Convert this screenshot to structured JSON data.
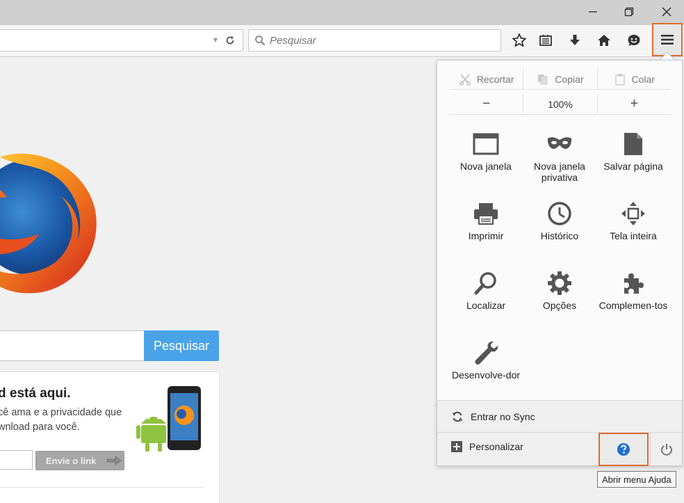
{
  "window": {
    "minimize_glyph": "—",
    "restore_glyph": "❐",
    "close_glyph": "✕"
  },
  "toolbar": {
    "search_placeholder": "Pesquisar",
    "icons": [
      "bookmark-star-icon",
      "reading-list-icon",
      "downloads-icon",
      "home-icon",
      "hello-chat-icon",
      "hamburger-menu-icon"
    ]
  },
  "page": {
    "search_button_label": "Pesquisar",
    "promo_title": "d está aqui.",
    "promo_text_line1": "cê ama e a privacidade que",
    "promo_text_line2": "wnload para você.",
    "send_link_label": "Envie o link"
  },
  "menu_panel": {
    "edit": {
      "cut_label": "Recortar",
      "copy_label": "Copiar",
      "paste_label": "Colar"
    },
    "zoom": {
      "out_label": "−",
      "level": "100%",
      "in_label": "+"
    },
    "items": [
      {
        "label": "Nova janela",
        "icon": "new-window-icon"
      },
      {
        "label": "Nova janela privativa",
        "icon": "private-mask-icon"
      },
      {
        "label": "Salvar página",
        "icon": "save-page-icon"
      },
      {
        "label": "Imprimir",
        "icon": "printer-icon"
      },
      {
        "label": "Histórico",
        "icon": "history-clock-icon"
      },
      {
        "label": "Tela inteira",
        "icon": "fullscreen-icon"
      },
      {
        "label": "Localizar",
        "icon": "find-magnifier-icon"
      },
      {
        "label": "Opções",
        "icon": "options-gear-icon"
      },
      {
        "label": "Complemen-tos",
        "icon": "addons-puzzle-icon"
      },
      {
        "label": "Desenvolve-dor",
        "icon": "developer-wrench-icon"
      }
    ],
    "sync_label": "Entrar no Sync",
    "customize_label": "Personalizar"
  },
  "tooltip": {
    "text": "Abrir menu Ajuda"
  },
  "colors": {
    "highlight_orange": "#e06a2c",
    "search_button_blue": "#4aa3e8",
    "help_blue": "#1f6fd1"
  }
}
